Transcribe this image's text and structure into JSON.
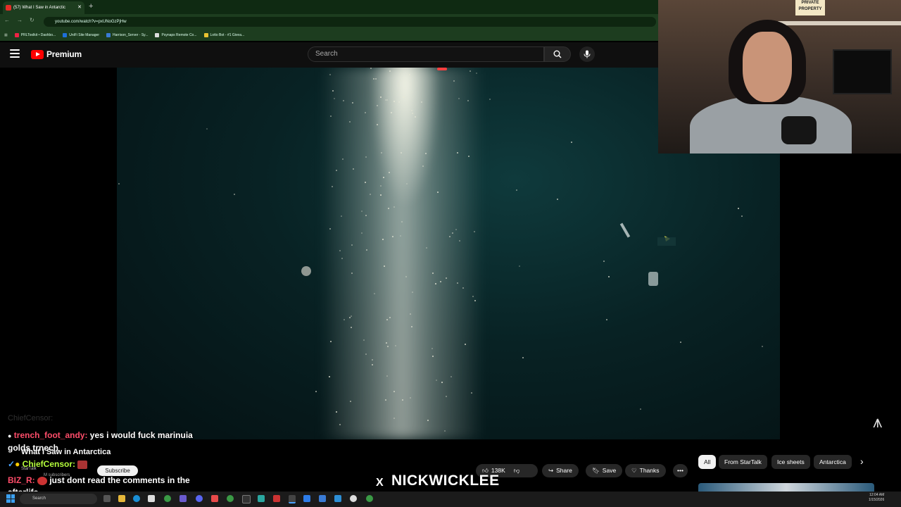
{
  "browser": {
    "tab_title": "(57) What I Saw in Antarctic",
    "new_tab": "+",
    "url": "youtube.com/watch?v=pxUNoGzPjHw",
    "bookmarks": [
      "PRLToolkit • Dashbo...",
      "UniFi Site Manager",
      "Harrison_Server - Sy...",
      "Psynaps Remote Co...",
      "Lotto Bot - #1 Givea..."
    ]
  },
  "youtube": {
    "logo_text": "Premium",
    "search_placeholder": "Search"
  },
  "webcam": {
    "sign_text": "PRIVATE PROPERTY"
  },
  "chat": {
    "faded_line": "ChiefCensor:",
    "messages": [
      {
        "user": "trench_foot_andy:",
        "text": " yes i would fuck marinuia",
        "text2": "golds trnech",
        "color": "#ff4d6a"
      },
      {
        "user": "ChiefCensor:",
        "text": "",
        "color": "#b5ff3c"
      },
      {
        "user": "BIZ_R:",
        "text": " just dont read the comments in the",
        "text2": "afterlife",
        "color": "#ff4d6a"
      }
    ]
  },
  "video": {
    "title": "What I Saw in Antarctica",
    "channel": "StarTalk",
    "subscribers": "M subscribers",
    "subscribe_label": "Subscribe",
    "likes": "138K",
    "share_label": "Share",
    "save_label": "Save",
    "thanks_label": "Thanks",
    "more_label": "•••"
  },
  "chips": [
    "All",
    "From StarTalk",
    "Ice sheets",
    "Antarctica"
  ],
  "overlay": {
    "streamer_name": "NICKWICKLEE",
    "x_logo": "X"
  },
  "taskbar": {
    "search_placeholder": "Search",
    "time": "12:04 AM",
    "date": "1/15/2026"
  },
  "colors": {
    "youtube_red": "#ff0000",
    "chrome_green": "#1d3d1f"
  }
}
